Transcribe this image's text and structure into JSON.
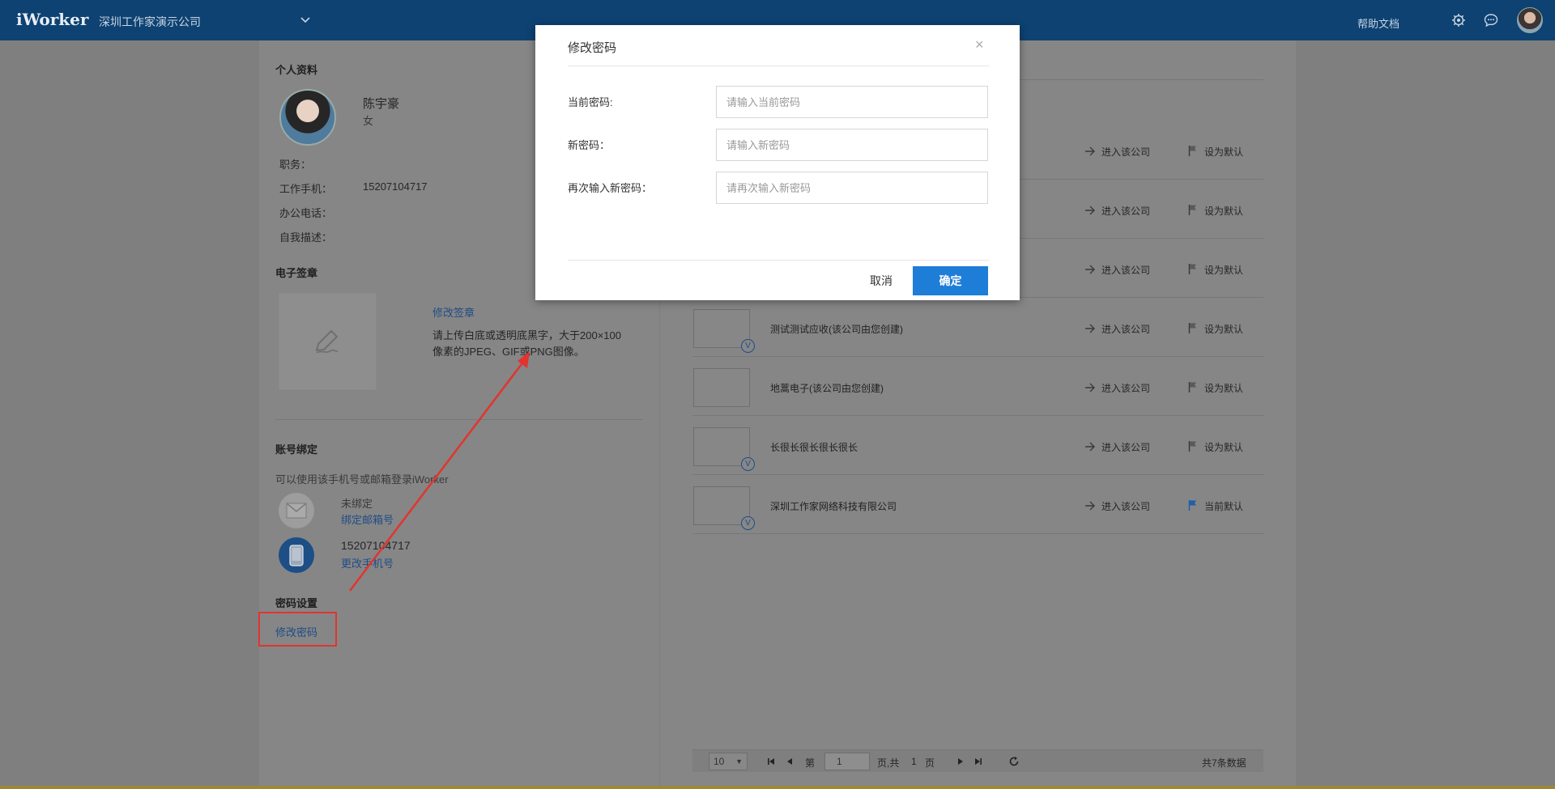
{
  "topbar": {
    "logo": "iWorker",
    "company": "深圳工作家演示公司",
    "help": "帮助文档",
    "icons": [
      "chevron-down-icon",
      "gear-icon",
      "chat-icon",
      "avatar"
    ]
  },
  "profile": {
    "section_title": "个人资料",
    "name": "陈宇豪",
    "gender": "女",
    "position_label": "职务：",
    "mobile_label": "工作手机：",
    "mobile_value": "15207104717",
    "office_label": "办公电话：",
    "desc_label": "自我描述："
  },
  "signature": {
    "section_title": "电子签章",
    "edit_link": "修改签章",
    "hint": "请上传白底或透明底黑字，大于200×100像素的JPEG、GIF或PNG图像。"
  },
  "binding": {
    "section_title": "账号绑定",
    "desc": "可以使用该手机号或邮箱登录iWorker",
    "email_status": "未绑定",
    "email_link": "绑定邮箱号",
    "phone_value": "15207104717",
    "phone_link": "更改手机号"
  },
  "password": {
    "section_title": "密码设置",
    "change_link": "修改密码"
  },
  "companies": {
    "enter_label": "进入该公司",
    "set_default_label": "设为默认",
    "current_default_label": "当前默认",
    "rows": [
      {
        "name": "",
        "badge": false,
        "default": false
      },
      {
        "name": "",
        "badge": false,
        "default": false
      },
      {
        "name": "",
        "badge": false,
        "default": false
      },
      {
        "name": "测试测试应收(该公司由您创建)",
        "badge": true,
        "default": false
      },
      {
        "name": "地蒿电子(该公司由您创建)",
        "badge": false,
        "default": false
      },
      {
        "name": "长很长很长很长很长",
        "badge": true,
        "default": false
      },
      {
        "name": "深圳工作家网络科技有限公司",
        "badge": true,
        "default": true
      }
    ],
    "badge_text": "V"
  },
  "pager": {
    "page_size": "10",
    "page_prefix": "第",
    "page_value": "1",
    "page_suffix": "页,共",
    "total_pages": "1",
    "page_unit": "页",
    "total_records": "共7条数据"
  },
  "modal": {
    "title": "修改密码",
    "close": "×",
    "current_label": "当前密码:",
    "current_placeholder": "请输入当前密码",
    "new_label": "新密码：",
    "new_placeholder": "请输入新密码",
    "confirm_label": "再次输入新密码：",
    "confirm_placeholder": "请再次输入新密码",
    "cancel": "取消",
    "ok": "确定"
  },
  "colors": {
    "topbar": "#0d4272",
    "primary": "#1e7dd7",
    "annotation": "#e2342f"
  }
}
